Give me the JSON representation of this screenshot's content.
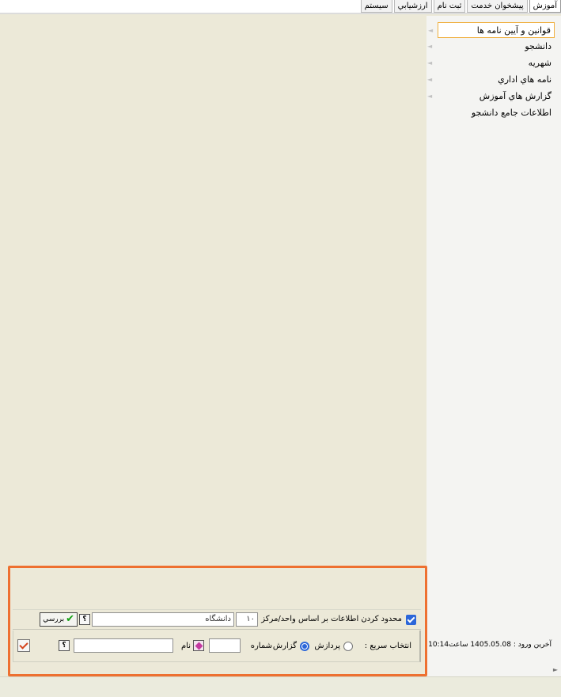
{
  "tabs": [
    {
      "label": "آموزش",
      "active": true
    },
    {
      "label": "پيشخوان خدمت",
      "active": false
    },
    {
      "label": "ثبت نام",
      "active": false
    },
    {
      "label": "ارزشيابي",
      "active": false
    },
    {
      "label": "سيستم",
      "active": false
    }
  ],
  "menu": [
    {
      "label": "قوانين و آيين نامه ها",
      "has_arrow": true
    },
    {
      "label": "دانشجو",
      "has_arrow": true
    },
    {
      "label": "شهريه",
      "has_arrow": true
    },
    {
      "label": "نامه هاي اداري",
      "has_arrow": true
    },
    {
      "label": "گزارش هاي آموزش",
      "has_arrow": true
    },
    {
      "label": "اطلاعات جامع دانشجو",
      "has_arrow": false
    }
  ],
  "menu_arrow_glyph": "◄",
  "last_login": "آخرين ورود : 1405.05.08 ساعت10:14",
  "filter": {
    "checked": true,
    "label": "محدود کردن اطلاعات بر اساس واحد/مرکز",
    "unit_code": "۱۰",
    "unit_name": "دانشگاه",
    "help_label": "؟",
    "check_button_label": "بررسي"
  },
  "quick": {
    "label": "انتخاب سريع :",
    "radio_process": "پردازش",
    "radio_report": "گزارش",
    "selected": "report",
    "number_label": "شماره",
    "number_value": "",
    "name_label": "نام",
    "name_value": "",
    "help_label": "؟"
  },
  "scroll_arrow": "►",
  "colors": {
    "highlight": "#ee7030",
    "accent": "#2b66d9",
    "selected_border": "#f0b040"
  }
}
